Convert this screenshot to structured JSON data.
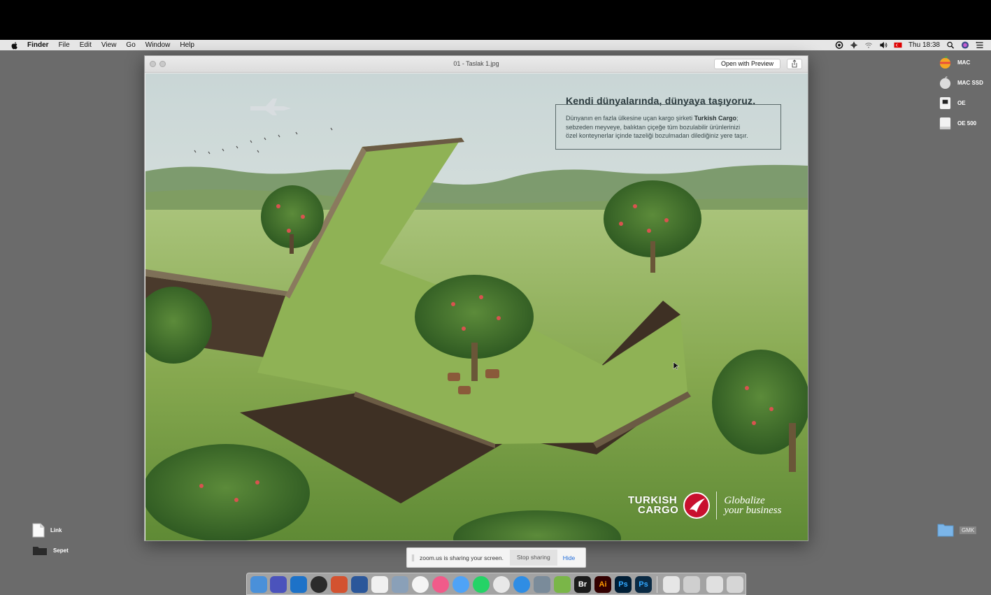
{
  "menubar": {
    "app_name": "Finder",
    "menus": [
      "File",
      "Edit",
      "View",
      "Go",
      "Window",
      "Help"
    ],
    "clock": "Thu 18:38"
  },
  "desktop": {
    "right_items": [
      "MAC",
      "MAC SSD",
      "OE",
      "OE 500"
    ],
    "left_items": [
      "Link",
      "Sepet"
    ],
    "bottom_right_item": "GMK"
  },
  "window": {
    "title": "01 - Taslak 1.jpg",
    "open_button": "Open with Preview"
  },
  "ad": {
    "headline": "Kendi dünyalarında, dünyaya taşıyoruz.",
    "body_line1_prefix": "Dünyanın en fazla ülkesine uçan kargo şirketi ",
    "body_line1_bold": "Turkish Cargo",
    "body_line1_suffix": ";",
    "body_line2": "sebzeden meyveye, balıktan çiçeğe tüm bozulabilir ürünlerinizi",
    "body_line3": "özel konteynerlar içinde tazeliği bozulmadan dilediğiniz yere taşır.",
    "logo_line1": "TURKISH",
    "logo_line2": "CARGO",
    "slogan_line1": "Globalize",
    "slogan_line2": "your business"
  },
  "zoom": {
    "sharing_text": "zoom.us is sharing your screen.",
    "stop_button": "Stop sharing",
    "hide_button": "Hide"
  },
  "dock": {
    "labels": [
      "Br",
      "Ai",
      "Ps",
      "Ps"
    ]
  },
  "colors": {
    "accent_red": "#c8102e",
    "zoom_blue": "#1f6ad9",
    "grass": "#8db05a"
  }
}
